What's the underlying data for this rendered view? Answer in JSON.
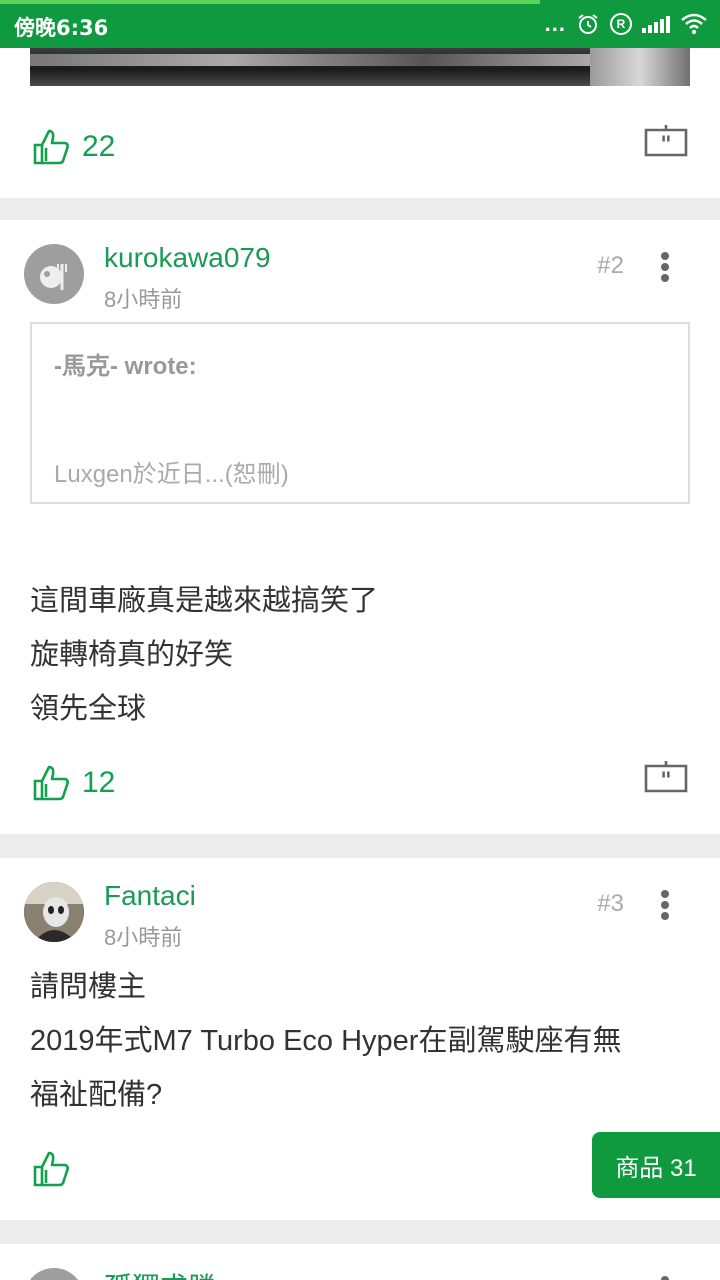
{
  "status_bar": {
    "time": "傍晚6:36",
    "dots": "...",
    "icons": [
      "alarm-icon",
      "r-icon",
      "signal-icon",
      "wifi-icon"
    ],
    "r_label": "R"
  },
  "colors": {
    "brand_green": "#0f9a3f",
    "username_green": "#1a9a55",
    "like_green": "#13a04c"
  },
  "posts": [
    {
      "likes": "22"
    },
    {
      "username": "kurokawa079",
      "time_ago": "8小時前",
      "floor": "#2",
      "quote": {
        "header": "-馬克- wrote:",
        "body": "Luxgen於近日...(恕刪)"
      },
      "lines": [
        "這間車廠真是越來越搞笑了",
        "旋轉椅真的好笑",
        "領先全球"
      ],
      "likes": "12"
    },
    {
      "username": "Fantaci",
      "time_ago": "8小時前",
      "floor": "#3",
      "lines": [
        "請問樓主",
        "2019年式M7 Turbo Eco Hyper在副駕駛座有無",
        "福祉配備?"
      ],
      "likes": ""
    },
    {
      "username": "孤獨求勝"
    }
  ],
  "fab": {
    "label": "商品 31"
  }
}
